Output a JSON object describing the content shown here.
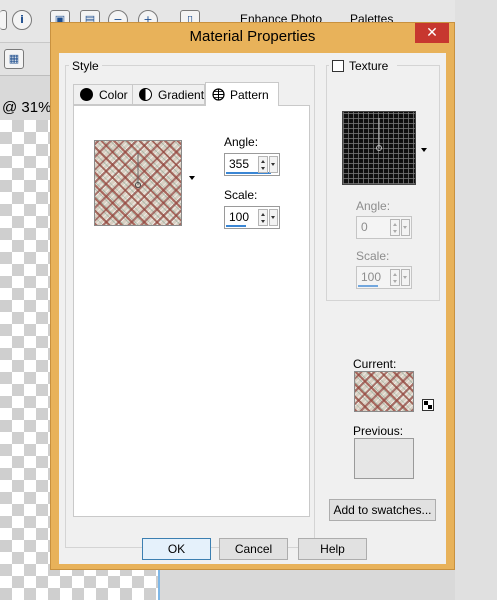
{
  "app": {
    "toolbar": {
      "enhance_label": "Enhance Photo",
      "palettes_label": "Palettes"
    },
    "zoom_text": "@ 31%."
  },
  "dialog": {
    "title": "Material Properties",
    "close_glyph": "✕",
    "style_group_label": "Style",
    "tabs": [
      {
        "label": "Color"
      },
      {
        "label": "Gradient"
      },
      {
        "label": "Pattern"
      }
    ],
    "pattern": {
      "angle_label": "Angle:",
      "angle_value": "355",
      "scale_label": "Scale:",
      "scale_value": "100"
    },
    "texture": {
      "checkbox_label": "Texture",
      "checked": false,
      "angle_label": "Angle:",
      "angle_value": "0",
      "scale_label": "Scale:",
      "scale_value": "100"
    },
    "current_label": "Current:",
    "previous_label": "Previous:",
    "add_to_swatches_label": "Add to swatches...",
    "buttons": {
      "ok": "OK",
      "cancel": "Cancel",
      "help": "Help"
    },
    "colors": {
      "frame": "#e8b25a",
      "close": "#c7372f",
      "accent": "#3a86d4"
    }
  }
}
